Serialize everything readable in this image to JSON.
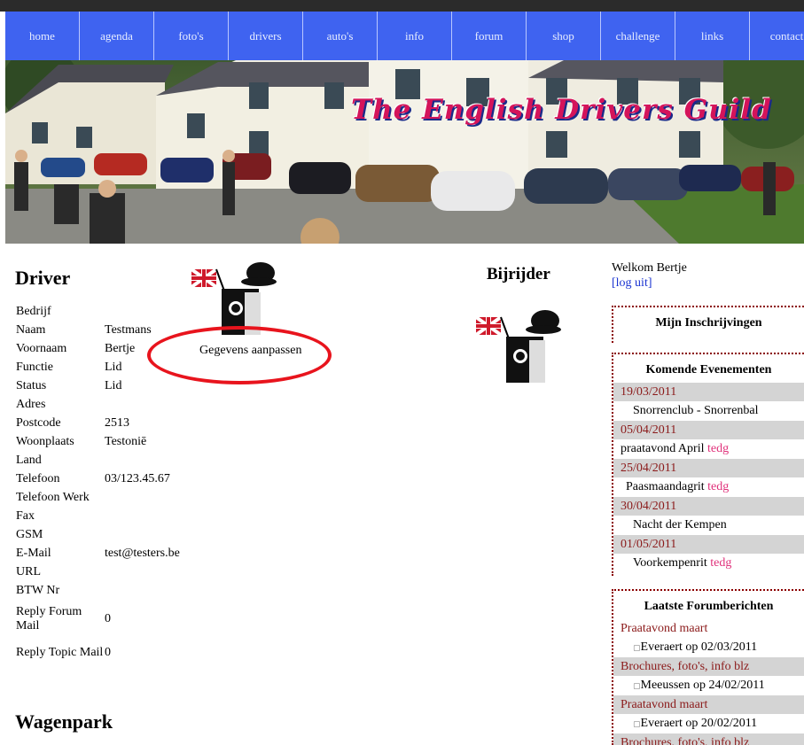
{
  "nav": {
    "items": [
      "home",
      "agenda",
      "foto's",
      "drivers",
      "auto's",
      "info",
      "forum",
      "shop",
      "challenge",
      "links",
      "contact"
    ]
  },
  "banner": {
    "title": "The English Drivers Guild"
  },
  "driver": {
    "heading": "Driver",
    "edit_link": "Gegevens aanpassen",
    "fields": [
      {
        "label": "Bedrijf",
        "value": ""
      },
      {
        "label": "Naam",
        "value": "Testmans"
      },
      {
        "label": "Voornaam",
        "value": "Bertje"
      },
      {
        "label": "Functie",
        "value": "Lid"
      },
      {
        "label": "Status",
        "value": "Lid"
      },
      {
        "label": "Adres",
        "value": ""
      },
      {
        "label": "Postcode",
        "value": "2513"
      },
      {
        "label": "Woonplaats",
        "value": "Testoniē"
      },
      {
        "label": "Land",
        "value": ""
      },
      {
        "label": "Telefoon",
        "value": "03/123.45.67"
      },
      {
        "label": "Telefoon Werk",
        "value": ""
      },
      {
        "label": "Fax",
        "value": ""
      },
      {
        "label": "GSM",
        "value": ""
      },
      {
        "label": "E-Mail",
        "value": "test@testers.be"
      },
      {
        "label": "URL",
        "value": ""
      },
      {
        "label": "BTW Nr",
        "value": ""
      },
      {
        "label": "Reply Forum Mail",
        "value": "0"
      },
      {
        "label": "Reply Topic Mail",
        "value": "0"
      }
    ]
  },
  "wagenpark": {
    "heading": "Wagenpark"
  },
  "bijrijder": {
    "heading": "Bijrijder"
  },
  "sidebar": {
    "welcome": "Welkom Bertje",
    "logout": "[log uit]",
    "inschrijvingen_title": "Mijn Inschrijvingen",
    "events_title": "Komende Evenementen",
    "events": [
      {
        "date": "19/03/2011",
        "name": "Snorrenclub - Snorrenbal",
        "tag": ""
      },
      {
        "date": "05/04/2011",
        "name": "praatavond April",
        "tag": "tedg"
      },
      {
        "date": "25/04/2011",
        "name": "Paasmaandagrit",
        "tag": "tedg"
      },
      {
        "date": "30/04/2011",
        "name": "Nacht der Kempen",
        "tag": ""
      },
      {
        "date": "01/05/2011",
        "name": "Voorkempenrit",
        "tag": "tedg"
      }
    ],
    "forum_title": "Laatste Forumberichten",
    "forum": [
      {
        "title": "Praatavond maart",
        "meta": "Everaert op 02/03/2011"
      },
      {
        "title": "Brochures, foto's, info blz",
        "meta": "Meeussen op 24/02/2011"
      },
      {
        "title": "Praatavond maart",
        "meta": "Everaert op 20/02/2011"
      },
      {
        "title": "Brochures, foto's, info blz",
        "meta": ""
      }
    ]
  }
}
